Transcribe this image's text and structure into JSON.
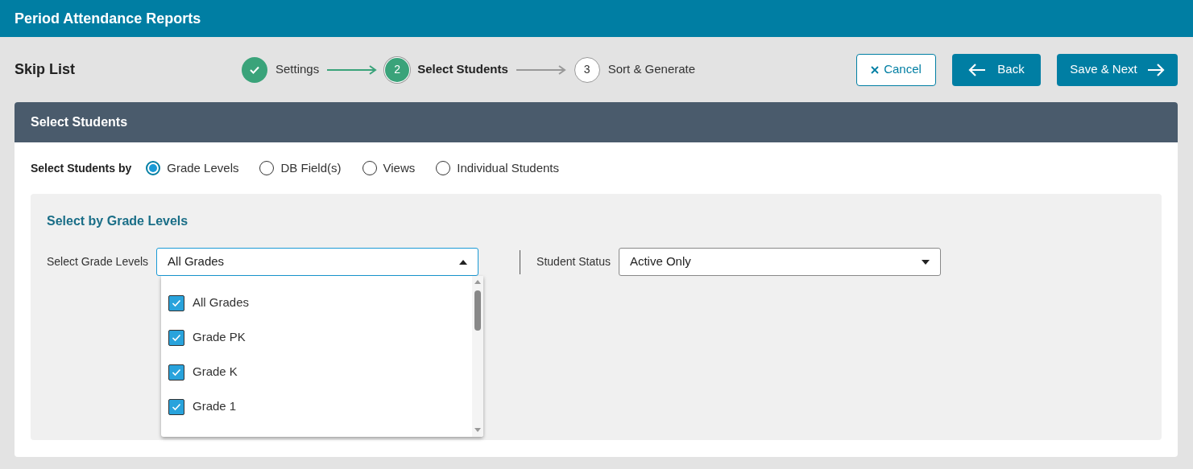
{
  "app_title": "Period Attendance Reports",
  "page_title": "Skip List",
  "steps": [
    {
      "label": "Settings",
      "done": true,
      "current": false
    },
    {
      "number": "2",
      "label": "Select Students",
      "done": false,
      "current": true
    },
    {
      "number": "3",
      "label": "Sort & Generate",
      "done": false,
      "current": false
    }
  ],
  "buttons": [
    {
      "label": "Cancel",
      "kind": "cancel"
    },
    {
      "label": "Back",
      "kind": "back"
    },
    {
      "label": "Save & Next",
      "kind": "next"
    }
  ],
  "panel": {
    "title": "Select Students",
    "select_by": {
      "label": "Select Students by",
      "options": [
        {
          "label": "Grade Levels",
          "selected": true
        },
        {
          "label": "DB Field(s)",
          "selected": false
        },
        {
          "label": "Views",
          "selected": false
        },
        {
          "label": "Individual Students",
          "selected": false
        }
      ]
    },
    "section_title": "Select by Grade Levels",
    "grade_levels": {
      "label": "Select Grade Levels",
      "value": "All Grades",
      "expanded": true,
      "options": [
        {
          "label": "All Grades",
          "checked": true
        },
        {
          "label": "Grade PK",
          "checked": true
        },
        {
          "label": "Grade K",
          "checked": true
        },
        {
          "label": "Grade 1",
          "checked": true
        }
      ]
    },
    "student_status": {
      "label": "Student Status",
      "value": "Active Only"
    }
  }
}
